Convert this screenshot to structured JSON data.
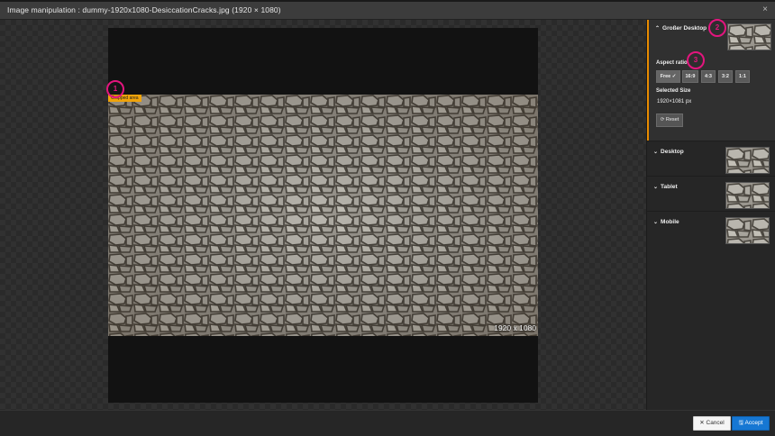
{
  "dialog": {
    "title": "Image manipulation : dummy-1920x1080-DesiccationCracks.jpg (1920 × 1080)",
    "close_symbol": "×"
  },
  "canvas": {
    "cropped_area_label": "Cropped area",
    "image_dimensions": "1920 x 1080"
  },
  "callouts": [
    "1",
    "2",
    "3"
  ],
  "sidebar": {
    "active_variant": {
      "title": "Großer Desktop",
      "aspect_ratio_label": "Aspect ratio",
      "ratios": [
        "Free ✓",
        "16:9",
        "4:3",
        "3:2",
        "1:1"
      ],
      "selected_size_label": "Selected Size",
      "selected_size_value": "1920×1081 px",
      "reset_label": "⟳ Reset"
    },
    "variants": [
      {
        "title": "Desktop"
      },
      {
        "title": "Tablet"
      },
      {
        "title": "Mobile"
      }
    ],
    "chevron_up": "⌃",
    "chevron_down": "⌄"
  },
  "footer": {
    "cancel_label": "✕ Cancel",
    "accept_label": "🖫 Accept"
  },
  "colors": {
    "accent": "#e88b00",
    "callout": "#e3157e",
    "accept": "#1677d3"
  }
}
